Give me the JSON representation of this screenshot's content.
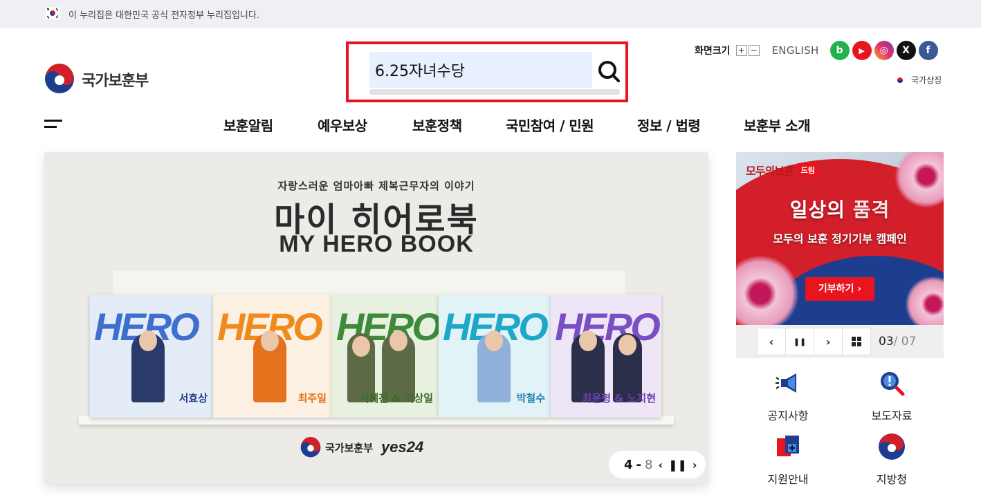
{
  "gov_banner": {
    "text": "이 누리집은 대한민국 공식 전자정부 누리집입니다."
  },
  "logo": {
    "name": "국가보훈부"
  },
  "search": {
    "value": "6.25자녀수당",
    "placeholder": ""
  },
  "utility": {
    "font_size_label": "화면크기",
    "font_plus": "+",
    "font_minus": "−",
    "english": "ENGLISH",
    "national_symbol": "국가상징"
  },
  "sns": [
    {
      "name": "blog",
      "glyph": "b",
      "color": "#22b24c"
    },
    {
      "name": "youtube",
      "glyph": "▶",
      "color": "#e8141e"
    },
    {
      "name": "instagram",
      "glyph": "◎",
      "color": "#c7307a"
    },
    {
      "name": "x",
      "glyph": "X",
      "color": "#111111"
    },
    {
      "name": "facebook",
      "glyph": "f",
      "color": "#3b5998"
    }
  ],
  "gnb": [
    "보훈알림",
    "예우보상",
    "보훈정책",
    "국민참여 / 민원",
    "정보 / 법령",
    "보훈부 소개"
  ],
  "hero": {
    "subtitle": "자랑스러운 엄마아빠 제복근무자의 이야기",
    "title_ko": "마이 히어로북",
    "title_en": "MY HERO BOOK",
    "books": [
      {
        "name": "서효상",
        "letter_color": "#3e6fcf",
        "bg": "#e4ecf7",
        "uniform": "#2a3a6c",
        "name_color": "#1f3a8a"
      },
      {
        "name": "최주일",
        "letter_color": "#f08a1c",
        "bg": "#fbf0e2",
        "uniform": "#e4721c",
        "name_color": "#e4721c"
      },
      {
        "name": "서혜진 & 이상일",
        "letter_color": "#3c8a3a",
        "bg": "#e8f0df",
        "uniform": "#5c6a45",
        "name_color": "#3c6a2a"
      },
      {
        "name": "박철수",
        "letter_color": "#1fa7c9",
        "bg": "#e2f3f8",
        "uniform": "#8fb0d9",
        "name_color": "#1f7fb0"
      },
      {
        "name": "최윤형 & 노지현",
        "letter_color": "#7a4fc4",
        "bg": "#eee6f7",
        "uniform": "#2c2f4a",
        "name_color": "#6a3fb4"
      }
    ],
    "brand_name": "국가보훈부",
    "partner": "yes24",
    "slide_current": "4",
    "slide_sep": "-",
    "slide_total": "8"
  },
  "side_banner": {
    "tag": "모두의보훈",
    "tag_badge": "드림",
    "headline_a": "일상의 ",
    "headline_b": "품격",
    "subline": "모두의 보훈 정기기부 캠페인",
    "cta": "기부하기 ›",
    "current": "03",
    "total": "/ 07"
  },
  "quick_links": [
    {
      "label": "공지사항",
      "icon": "megaphone-icon"
    },
    {
      "label": "보도자료",
      "icon": "magnifier-icon"
    },
    {
      "label": "지원안내",
      "icon": "documents-icon"
    },
    {
      "label": "지방청",
      "icon": "emblem-icon"
    }
  ],
  "colors": {
    "accent_red": "#e8141e",
    "navy": "#1d3e8f",
    "search_fill": "#e8f0fe"
  }
}
